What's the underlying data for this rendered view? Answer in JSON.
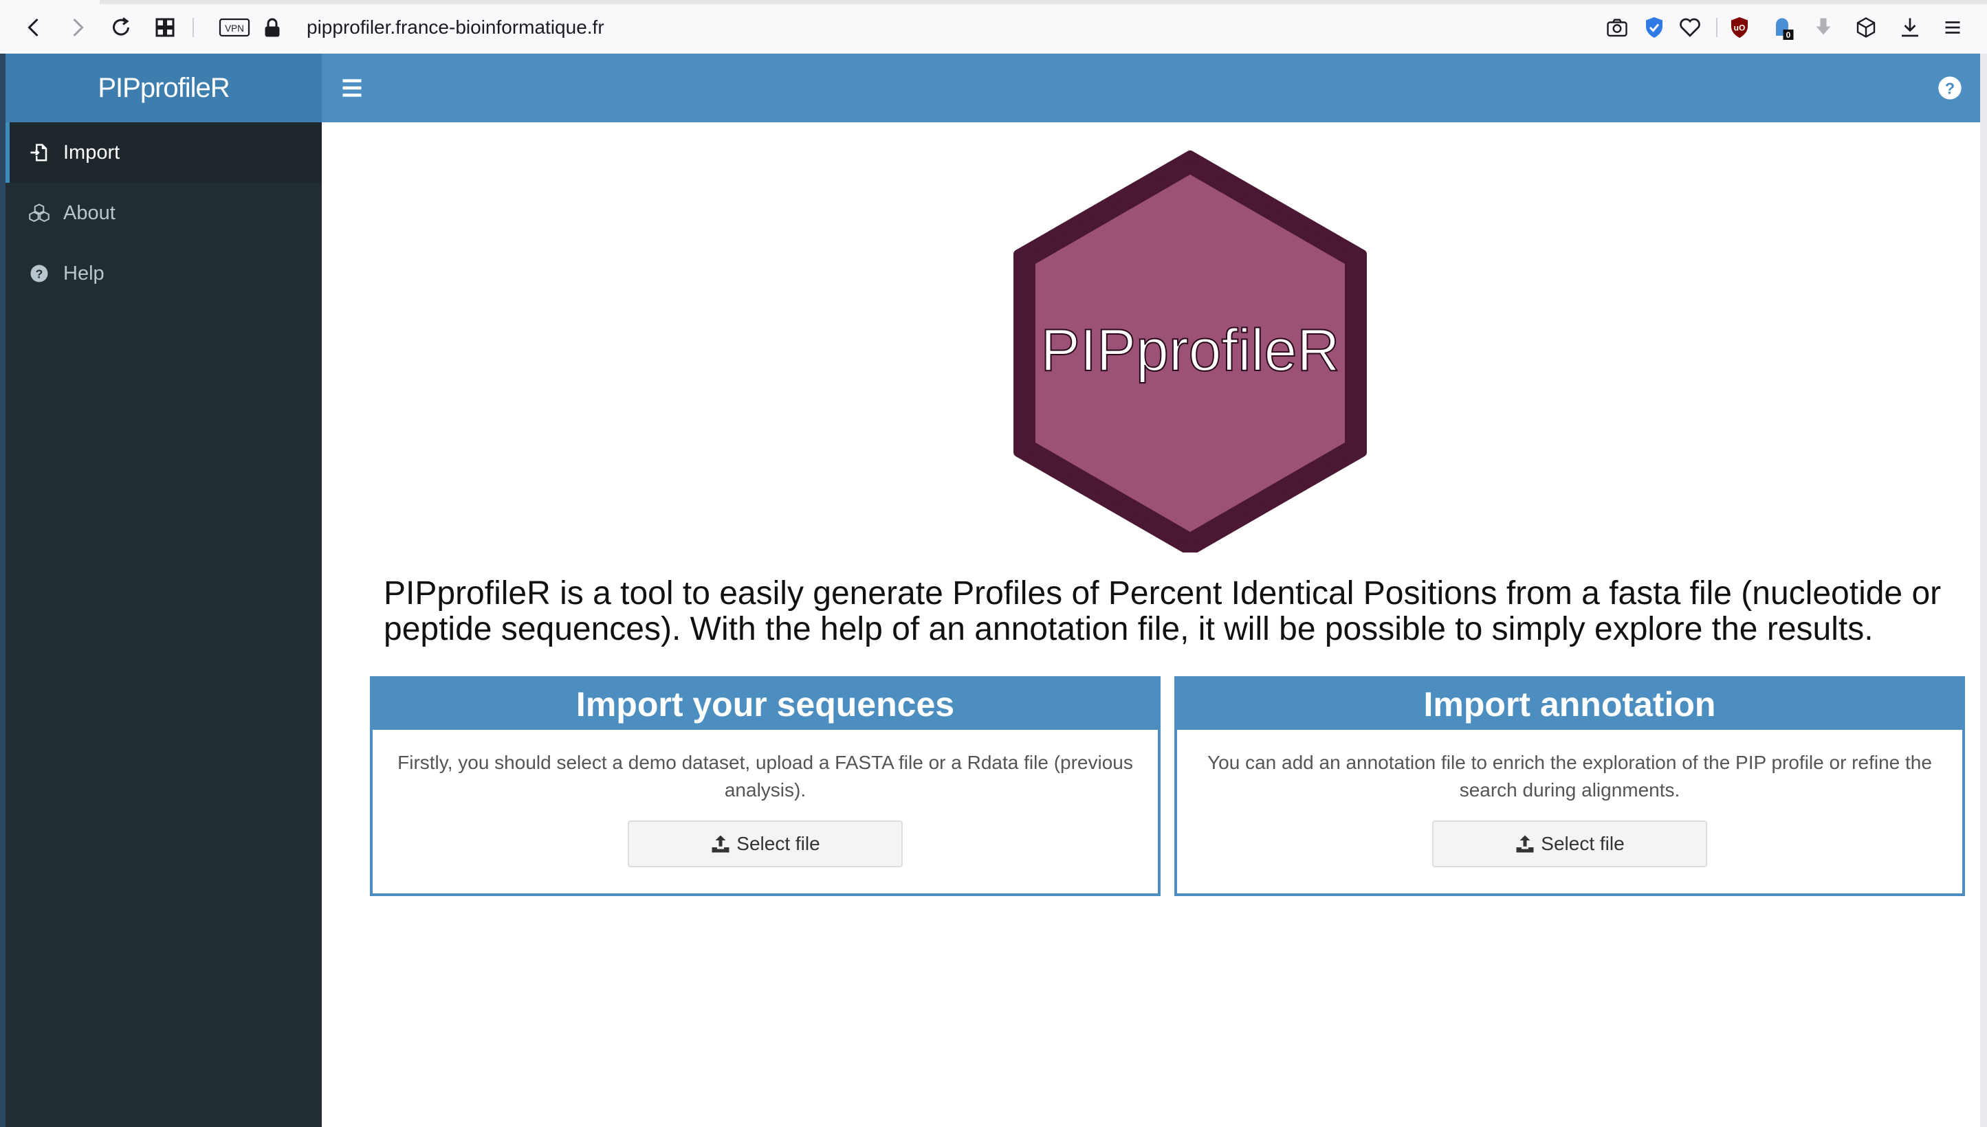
{
  "browser": {
    "url": "pipprofiler.france-bioinformatique.fr",
    "vpn_label": "VPN",
    "ext_badge": "0"
  },
  "app": {
    "brand": "PIPprofileR"
  },
  "sidebar": {
    "items": [
      {
        "label": "Import",
        "icon": "file-import-icon",
        "active": true
      },
      {
        "label": "About",
        "icon": "cubes-icon",
        "active": false
      },
      {
        "label": "Help",
        "icon": "question-circle-icon",
        "active": false
      }
    ]
  },
  "main": {
    "logo_text": "PIPprofileR",
    "description": "PIPprofileR is a tool to easily generate Profiles of Percent Identical Positions from a fasta file (nucleotide or peptide sequences). With the help of an annotation file, it will be possible to simply explore the results.",
    "boxes": [
      {
        "title": "Import your sequences",
        "text": "Firstly, you should select a demo dataset, upload a FASTA file or a Rdata file (previous analysis).",
        "button": "Select file"
      },
      {
        "title": "Import annotation",
        "text": "You can add an annotation file to enrich the exploration of the PIP profile or refine the search during alignments.",
        "button": "Select file"
      }
    ]
  },
  "colors": {
    "header": "#4c8ebf",
    "brand_bg": "#3e7eaf",
    "sidebar": "#222d32",
    "hex_fill": "#9b5275",
    "hex_border": "#4a1833"
  }
}
